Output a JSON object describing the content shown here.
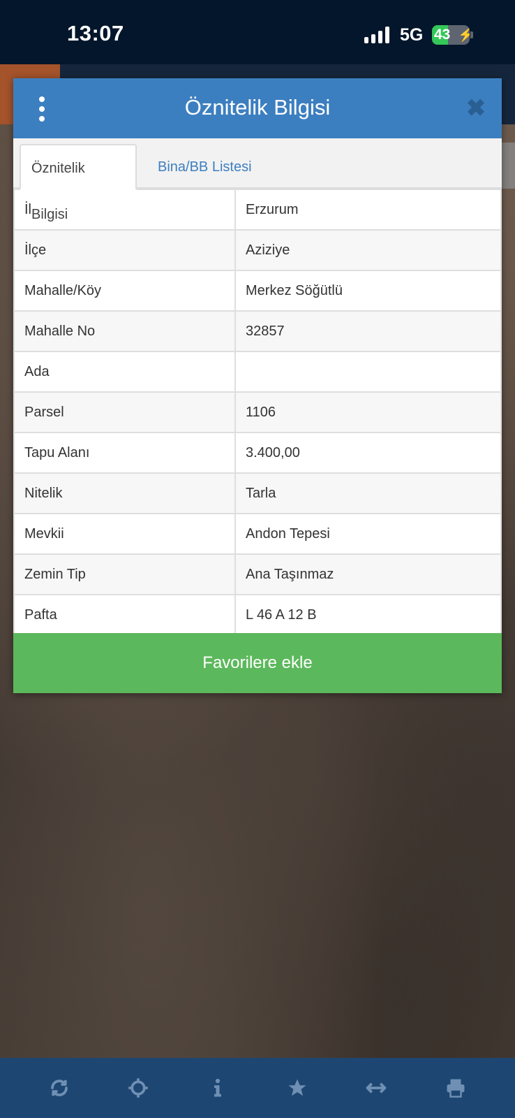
{
  "status_bar": {
    "time": "13:07",
    "network": "5G",
    "battery": "43",
    "battery_percent": 43
  },
  "modal": {
    "title": "Öznitelik Bilgisi",
    "tabs": [
      {
        "label": "Öznitelik Bilgisi",
        "active": true
      },
      {
        "label": "Bina/BB Listesi",
        "active": false
      }
    ],
    "rows": [
      {
        "key": "İl",
        "value": "Erzurum"
      },
      {
        "key": "İlçe",
        "value": "Aziziye"
      },
      {
        "key": "Mahalle/Köy",
        "value": "Merkez Söğütlü"
      },
      {
        "key": "Mahalle No",
        "value": "32857"
      },
      {
        "key": "Ada",
        "value": ""
      },
      {
        "key": "Parsel",
        "value": "1106"
      },
      {
        "key": "Tapu Alanı",
        "value": "3.400,00"
      },
      {
        "key": "Nitelik",
        "value": "Tarla"
      },
      {
        "key": "Mevkii",
        "value": "Andon Tepesi"
      },
      {
        "key": "Zemin Tip",
        "value": "Ana Taşınmaz"
      },
      {
        "key": "Pafta",
        "value": "L 46 A 12 B"
      }
    ],
    "favorite_button": "Favorilere ekle"
  },
  "toolbar": {
    "icons": [
      "refresh-icon",
      "locate-icon",
      "info-icon",
      "star-icon",
      "measure-icon",
      "print-icon"
    ]
  },
  "colors": {
    "header_blue": "#3c7fc0",
    "favorite_green": "#5cb85c",
    "toolbar_blue": "#1d4672",
    "status_bar": "#03162b"
  }
}
